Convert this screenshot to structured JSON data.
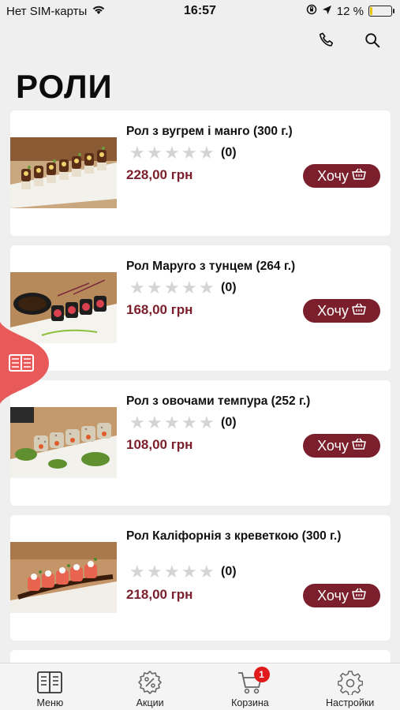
{
  "status_bar": {
    "carrier": "Нет SIM-карты",
    "time": "16:57",
    "battery": "12 %",
    "battery_level": 0.12
  },
  "header": {
    "title": "РОЛИ",
    "icons": [
      "phone-icon",
      "search-icon"
    ]
  },
  "products": [
    {
      "title": "Рол з вугрем і манго (300 г.)",
      "rating_count": "(0)",
      "price": "228,00 грн",
      "button": "Хочу"
    },
    {
      "title": "Рол Маруго з тунцем (264 г.)",
      "rating_count": "(0)",
      "price": "168,00 грн",
      "button": "Хочу"
    },
    {
      "title": "Рол з овочами темпура (252 г.)",
      "rating_count": "(0)",
      "price": "108,00 грн",
      "button": "Хочу"
    },
    {
      "title": "Рол Каліфорнія з креветкою (300 г.)",
      "rating_count": "(0)",
      "price": "218,00 грн",
      "button": "Хочу"
    }
  ],
  "tab_bar": {
    "items": [
      {
        "label": "Меню",
        "icon": "menu-book-icon"
      },
      {
        "label": "Акции",
        "icon": "discount-icon"
      },
      {
        "label": "Корзина",
        "icon": "cart-icon",
        "badge": "1"
      },
      {
        "label": "Настройки",
        "icon": "gear-icon"
      }
    ]
  },
  "colors": {
    "accent": "#7a1f2b",
    "side_tab": "#e85a5a",
    "badge": "#e11b1b",
    "background": "#efefef"
  }
}
